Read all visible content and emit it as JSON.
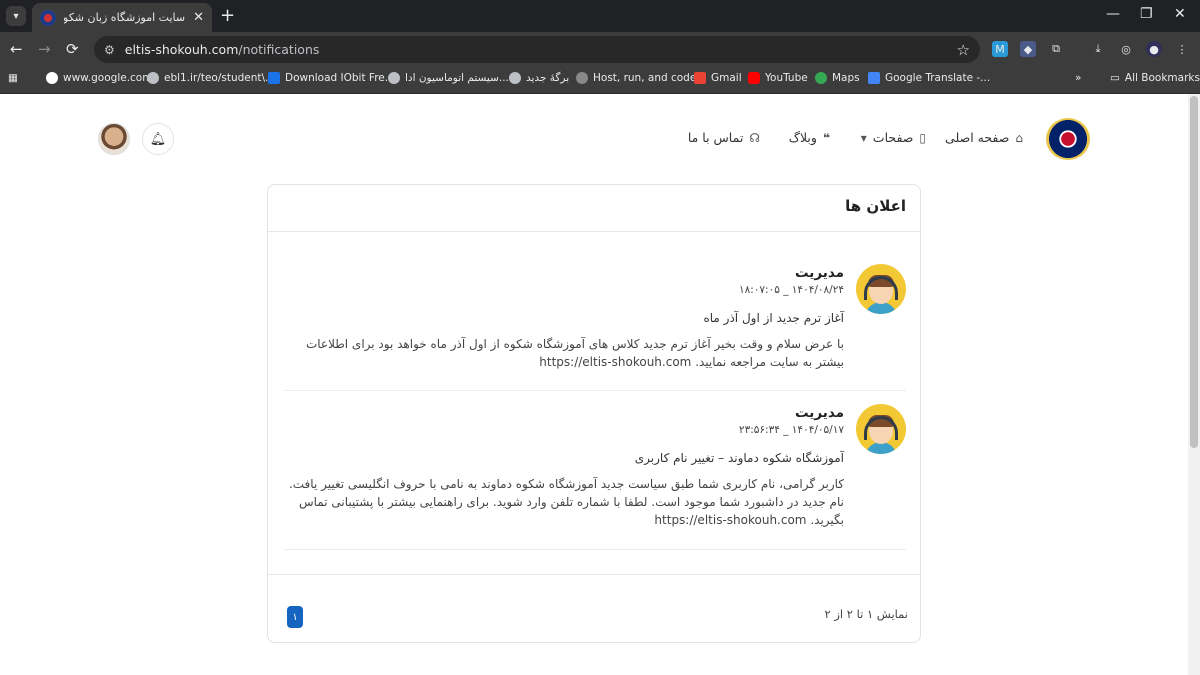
{
  "browser": {
    "tab": {
      "title": "سایت اموزشگاه زبان شکوه دماوند",
      "close": "✕"
    },
    "new_tab": "+",
    "window_controls": {
      "minimize": "—",
      "maximize": "❐",
      "close": "✕"
    },
    "nav": {
      "back": "←",
      "forward": "→",
      "reload": "⟳"
    },
    "address": {
      "host": "eltis-shokouh.com",
      "path": "/notifications"
    },
    "bookmarks": [
      {
        "label": "www.google.com",
        "color": "#ffffff"
      },
      {
        "label": "ebl1.ir/teo/student\\...",
        "color": "#bdc1c6"
      },
      {
        "label": "Download IObit Fre...",
        "color": "#1a73e8"
      },
      {
        "label": "سیستم اتوماسیون ادا...",
        "color": "#bdc1c6"
      },
      {
        "label": "برگهٔ جدید",
        "color": "#bdc1c6"
      },
      {
        "label": "Host, run, and code...",
        "color": "#888888"
      },
      {
        "label": "Gmail",
        "color": "#ea4335"
      },
      {
        "label": "YouTube",
        "color": "#ff0000"
      },
      {
        "label": "Maps",
        "color": "#34a853"
      },
      {
        "label": "Google Translate -...",
        "color": "#4285f4"
      }
    ],
    "overflow": "»",
    "all_bookmarks": "All Bookmarks"
  },
  "site": {
    "nav": {
      "home": "صفحه اصلی",
      "pages": "صفحات",
      "blog": "وبلاگ",
      "contact": "تماس با ما"
    }
  },
  "notifications": {
    "title": "اعلان ها",
    "items": [
      {
        "author": "مدیریت",
        "date": "۱۴۰۴/۰۸/۲۴ _ ۱۸:۰۷:۰۵",
        "subject": "آغاز ترم جدید از اول آذر ماه",
        "message": "با عرض سلام و وقت بخیر آغاز ترم جدید کلاس های آموزشگاه شکوه از اول آذر ماه خواهد بود برای اطلاعات بیشتر به سایت مراجعه نمایید.",
        "link": "https://eltis-shokouh.com"
      },
      {
        "author": "مدیریت",
        "date": "۱۴۰۴/۰۵/۱۷ _ ۲۳:۵۶:۳۴",
        "subject": "آموزشگاه شکوه دماوند – تغییر نام کاربری",
        "message": "کاربر گرامی، نام کاربری شما طبق سیاست جدید آموزشگاه شکوه دماوند به نامی با حروف انگلیسی تغییر یافت. نام جدید در داشبورد شما موجود است. لطفا با شماره تلفن وارد شوید. برای راهنمایی بیشتر با پشتیبانی تماس بگیرید.",
        "link": "https://eltis-shokouh.com"
      }
    ],
    "pagination": {
      "info": "نمایش ۱ تا ۲ از ۲",
      "current_page": "۱"
    }
  }
}
